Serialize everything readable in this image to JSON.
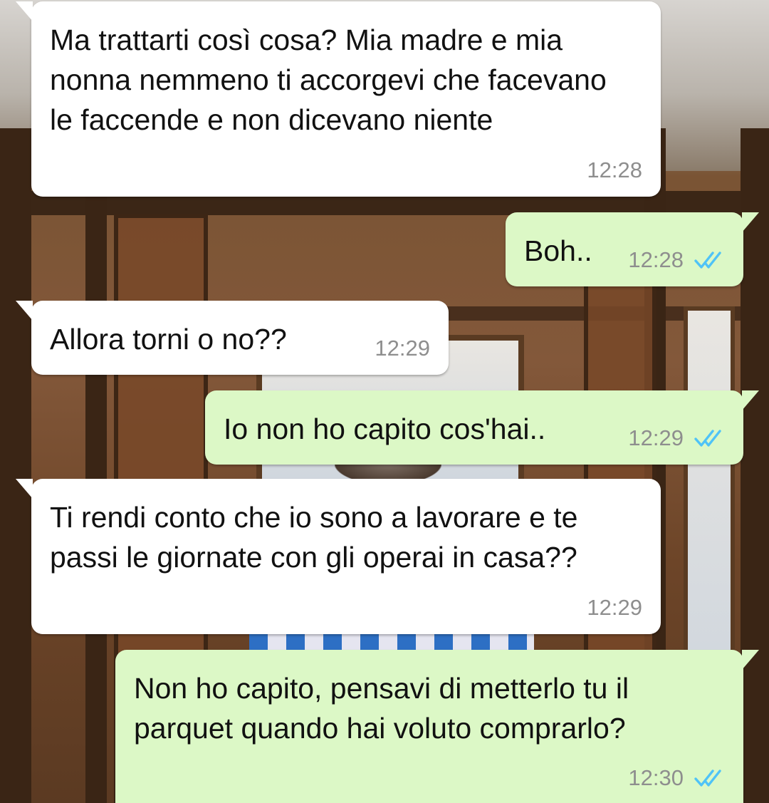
{
  "chat": {
    "messages": [
      {
        "direction": "incoming",
        "text": "Ma trattarti così cosa? Mia madre e mia nonna nemmeno ti accorgevi che facevano le faccende e non dicevano niente",
        "time": "12:28"
      },
      {
        "direction": "outgoing",
        "text": "Boh..",
        "time": "12:28",
        "status": "read"
      },
      {
        "direction": "incoming",
        "text": "Allora torni o no??",
        "time": "12:29"
      },
      {
        "direction": "outgoing",
        "text": "Io non ho capito cos'hai..",
        "time": "12:29",
        "status": "read"
      },
      {
        "direction": "incoming",
        "text": "Ti rendi conto che io sono a lavorare e te passi le giornate con gli operai in casa??",
        "time": "12:29"
      },
      {
        "direction": "outgoing",
        "text": "Non ho capito, pensavi di metterlo tu il parquet quando hai voluto comprarlo?",
        "time": "12:30",
        "status": "read"
      }
    ]
  },
  "colors": {
    "incoming_bubble": "#ffffff",
    "outgoing_bubble": "#dcf8c6",
    "read_ticks": "#4fc3f7",
    "timestamp": "#8e8e8e"
  },
  "icons": {
    "read_receipt": "double-check-icon",
    "wallpaper": "wooden-room-wallpaper"
  }
}
